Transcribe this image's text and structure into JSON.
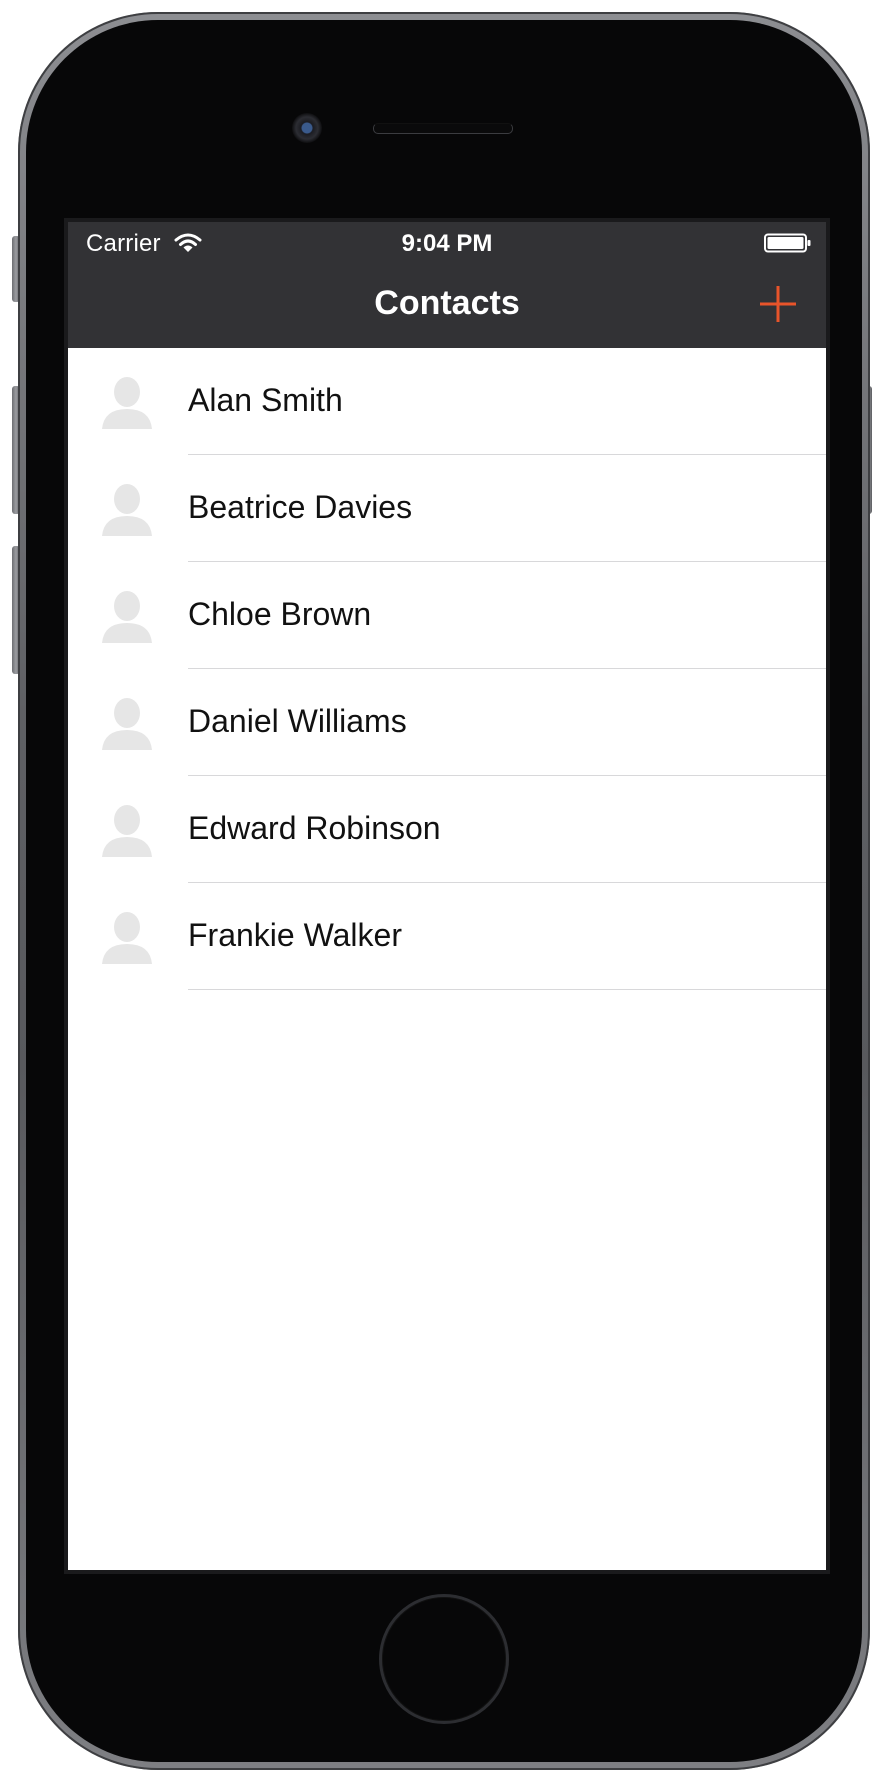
{
  "status_bar": {
    "carrier": "Carrier",
    "time": "9:04 PM"
  },
  "nav_bar": {
    "title": "Contacts",
    "add_icon": "plus-icon"
  },
  "contacts": [
    {
      "name": "Alan Smith",
      "icon": "person-placeholder-icon"
    },
    {
      "name": "Beatrice Davies",
      "icon": "person-placeholder-icon"
    },
    {
      "name": "Chloe Brown",
      "icon": "person-placeholder-icon"
    },
    {
      "name": "Daniel Williams",
      "icon": "person-placeholder-icon"
    },
    {
      "name": "Edward Robinson",
      "icon": "person-placeholder-icon"
    },
    {
      "name": "Frankie Walker",
      "icon": "person-placeholder-icon"
    }
  ],
  "colors": {
    "bar_background": "#323235",
    "accent": "#e8542a",
    "avatar": "#e6e6e6",
    "separator": "#d8d8da"
  }
}
